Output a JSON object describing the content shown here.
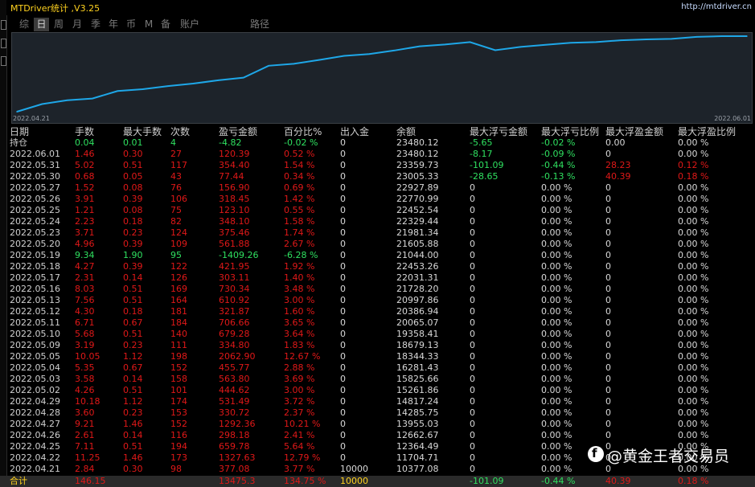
{
  "app": {
    "title": "MTDriver统计 ,V3.25",
    "url": "http://mtdriver.cn"
  },
  "tabs": [
    "综",
    "日",
    "周",
    "月",
    "季",
    "年",
    "币",
    "M",
    "备",
    "账户",
    "路径"
  ],
  "active_tab": "日",
  "chart_data": {
    "type": "line",
    "x_start_label": "2022.04.21",
    "x_end_label": "2022.06.01",
    "x": [
      "2022.04.21",
      "2022.04.22",
      "2022.04.25",
      "2022.04.26",
      "2022.04.27",
      "2022.04.28",
      "2022.04.29",
      "2022.05.02",
      "2022.05.03",
      "2022.05.04",
      "2022.05.05",
      "2022.05.09",
      "2022.05.10",
      "2022.05.11",
      "2022.05.12",
      "2022.05.13",
      "2022.05.16",
      "2022.05.17",
      "2022.05.18",
      "2022.05.19",
      "2022.05.20",
      "2022.05.23",
      "2022.05.24",
      "2022.05.25",
      "2022.05.26",
      "2022.05.27",
      "2022.05.30",
      "2022.05.31",
      "2022.06.01",
      "持仓"
    ],
    "values": [
      10377.08,
      11704.71,
      12364.49,
      12662.67,
      13955.03,
      14285.75,
      14817.24,
      15261.86,
      15825.66,
      16281.43,
      18344.33,
      18679.13,
      19358.41,
      20065.07,
      20386.94,
      20997.86,
      21728.2,
      22031.31,
      22453.26,
      21044.0,
      21605.88,
      21981.34,
      22329.44,
      22452.54,
      22770.99,
      22927.89,
      23005.33,
      23359.73,
      23480.12,
      23480.12
    ],
    "line_color": "#1ea7e8"
  },
  "table": {
    "headers": [
      "日期",
      "手数",
      "最大手数",
      "次数",
      "盈亏金额",
      "百分比%",
      "出入金",
      "余额",
      "最大浮亏金额",
      "最大浮亏比例",
      "最大浮盈金额",
      "最大浮盈比例"
    ],
    "hold_row": [
      "持仓",
      "0.04",
      "0.01",
      "4",
      "-4.82",
      "-0.02 %",
      "0",
      "23480.12",
      "-5.65",
      "-0.02 %",
      "0.00",
      "0.00 %"
    ],
    "rows": [
      [
        "2022.06.01",
        "1.46",
        "0.30",
        "27",
        "120.39",
        "0.52 %",
        "0",
        "23480.12",
        "-8.17",
        "-0.09 %",
        "0",
        "0.00 %"
      ],
      [
        "2022.05.31",
        "5.02",
        "0.51",
        "117",
        "354.40",
        "1.54 %",
        "0",
        "23359.73",
        "-101.09",
        "-0.44 %",
        "28.23",
        "0.12 %"
      ],
      [
        "2022.05.30",
        "0.68",
        "0.05",
        "43",
        "77.44",
        "0.34 %",
        "0",
        "23005.33",
        "-28.65",
        "-0.13 %",
        "40.39",
        "0.18 %"
      ],
      [
        "2022.05.27",
        "1.52",
        "0.08",
        "76",
        "156.90",
        "0.69 %",
        "0",
        "22927.89",
        "0",
        "0.00 %",
        "0",
        "0.00 %"
      ],
      [
        "2022.05.26",
        "3.91",
        "0.39",
        "106",
        "318.45",
        "1.42 %",
        "0",
        "22770.99",
        "0",
        "0.00 %",
        "0",
        "0.00 %"
      ],
      [
        "2022.05.25",
        "1.21",
        "0.08",
        "75",
        "123.10",
        "0.55 %",
        "0",
        "22452.54",
        "0",
        "0.00 %",
        "0",
        "0.00 %"
      ],
      [
        "2022.05.24",
        "2.23",
        "0.18",
        "82",
        "348.10",
        "1.58 %",
        "0",
        "22329.44",
        "0",
        "0.00 %",
        "0",
        "0.00 %"
      ],
      [
        "2022.05.23",
        "3.71",
        "0.23",
        "124",
        "375.46",
        "1.74 %",
        "0",
        "21981.34",
        "0",
        "0.00 %",
        "0",
        "0.00 %"
      ],
      [
        "2022.05.20",
        "4.96",
        "0.39",
        "109",
        "561.88",
        "2.67 %",
        "0",
        "21605.88",
        "0",
        "0.00 %",
        "0",
        "0.00 %"
      ],
      [
        "2022.05.19",
        "9.34",
        "1.90",
        "95",
        "-1409.26",
        "-6.28 %",
        "0",
        "21044.00",
        "0",
        "0.00 %",
        "0",
        "0.00 %"
      ],
      [
        "2022.05.18",
        "4.27",
        "0.39",
        "122",
        "421.95",
        "1.92 %",
        "0",
        "22453.26",
        "0",
        "0.00 %",
        "0",
        "0.00 %"
      ],
      [
        "2022.05.17",
        "2.31",
        "0.14",
        "126",
        "303.11",
        "1.40 %",
        "0",
        "22031.31",
        "0",
        "0.00 %",
        "0",
        "0.00 %"
      ],
      [
        "2022.05.16",
        "8.03",
        "0.51",
        "169",
        "730.34",
        "3.48 %",
        "0",
        "21728.20",
        "0",
        "0.00 %",
        "0",
        "0.00 %"
      ],
      [
        "2022.05.13",
        "7.56",
        "0.51",
        "164",
        "610.92",
        "3.00 %",
        "0",
        "20997.86",
        "0",
        "0.00 %",
        "0",
        "0.00 %"
      ],
      [
        "2022.05.12",
        "4.30",
        "0.18",
        "181",
        "321.87",
        "1.60 %",
        "0",
        "20386.94",
        "0",
        "0.00 %",
        "0",
        "0.00 %"
      ],
      [
        "2022.05.11",
        "6.71",
        "0.67",
        "184",
        "706.66",
        "3.65 %",
        "0",
        "20065.07",
        "0",
        "0.00 %",
        "0",
        "0.00 %"
      ],
      [
        "2022.05.10",
        "5.68",
        "0.51",
        "140",
        "679.28",
        "3.64 %",
        "0",
        "19358.41",
        "0",
        "0.00 %",
        "0",
        "0.00 %"
      ],
      [
        "2022.05.09",
        "3.19",
        "0.23",
        "111",
        "334.80",
        "1.83 %",
        "0",
        "18679.13",
        "0",
        "0.00 %",
        "0",
        "0.00 %"
      ],
      [
        "2022.05.05",
        "10.05",
        "1.12",
        "198",
        "2062.90",
        "12.67 %",
        "0",
        "18344.33",
        "0",
        "0.00 %",
        "0",
        "0.00 %"
      ],
      [
        "2022.05.04",
        "5.35",
        "0.67",
        "152",
        "455.77",
        "2.88 %",
        "0",
        "16281.43",
        "0",
        "0.00 %",
        "0",
        "0.00 %"
      ],
      [
        "2022.05.03",
        "3.58",
        "0.14",
        "158",
        "563.80",
        "3.69 %",
        "0",
        "15825.66",
        "0",
        "0.00 %",
        "0",
        "0.00 %"
      ],
      [
        "2022.05.02",
        "4.26",
        "0.51",
        "101",
        "444.62",
        "3.00 %",
        "0",
        "15261.86",
        "0",
        "0.00 %",
        "0",
        "0.00 %"
      ],
      [
        "2022.04.29",
        "10.18",
        "1.12",
        "174",
        "531.49",
        "3.72 %",
        "0",
        "14817.24",
        "0",
        "0.00 %",
        "0",
        "0.00 %"
      ],
      [
        "2022.04.28",
        "3.60",
        "0.23",
        "153",
        "330.72",
        "2.37 %",
        "0",
        "14285.75",
        "0",
        "0.00 %",
        "0",
        "0.00 %"
      ],
      [
        "2022.04.27",
        "9.21",
        "1.46",
        "152",
        "1292.36",
        "10.21 %",
        "0",
        "13955.03",
        "0",
        "0.00 %",
        "0",
        "0.00 %"
      ],
      [
        "2022.04.26",
        "2.61",
        "0.14",
        "116",
        "298.18",
        "2.41 %",
        "0",
        "12662.67",
        "0",
        "0.00 %",
        "0",
        "0.00 %"
      ],
      [
        "2022.04.25",
        "7.11",
        "0.51",
        "194",
        "659.78",
        "5.64 %",
        "0",
        "12364.49",
        "0",
        "0.00 %",
        "0",
        "0.00 %"
      ],
      [
        "2022.04.22",
        "11.25",
        "1.46",
        "173",
        "1327.63",
        "12.79 %",
        "0",
        "11704.71",
        "0",
        "0.00 %",
        "0",
        "0.00 %"
      ],
      [
        "2022.04.21",
        "2.84",
        "0.30",
        "98",
        "377.08",
        "3.77 %",
        "10000",
        "10377.08",
        "0",
        "0.00 %",
        "0",
        "0.00 %"
      ]
    ],
    "total_row": [
      "合计",
      "146.15",
      "",
      "",
      "13475.3",
      "134.75 %",
      "10000",
      "",
      "-101.09",
      "-0.44 %",
      "40.39",
      "0.18 %"
    ]
  },
  "watermark": {
    "logo_glyph": "f",
    "text": "@黄金王者交易员"
  },
  "colors": {
    "positive": "#e01818",
    "negative": "#2fe060",
    "neutral": "#d8d8d8",
    "label": "#cfcfcf",
    "accent": "#ffd21f"
  }
}
